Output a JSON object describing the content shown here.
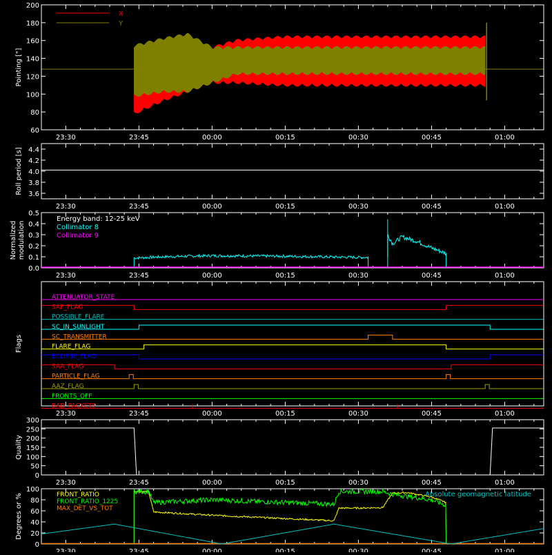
{
  "colors": {
    "background": "#000000",
    "axis": "#ffffff",
    "red": "#ff0000",
    "olive": "#808000",
    "cyan": "#00ffff",
    "magenta": "#ff00ff",
    "yellow": "#ffff00",
    "green": "#00ff00",
    "orange": "#ff8000",
    "blue": "#0000ff",
    "teal": "#00c0c0",
    "dark_yellow": "#a0a000"
  },
  "time_ticks": [
    "23:30",
    "23:45",
    "00:00",
    "00:15",
    "00:30",
    "00:45",
    "01:00"
  ],
  "chart_data": [
    {
      "id": "pointing",
      "type": "area",
      "ylabel": "Pointing [\"]",
      "ylim": [
        60,
        200
      ],
      "yticks": [
        60,
        80,
        100,
        120,
        140,
        160,
        180,
        200
      ],
      "legend_placement": "top-left",
      "x_range": [
        "23:25",
        "01:08"
      ],
      "series": [
        {
          "name": "X",
          "color": "#ff0000",
          "x": [
            "23:44",
            "23:50",
            "23:55",
            "00:00",
            "00:05",
            "00:15",
            "00:30",
            "00:45",
            "00:56"
          ],
          "upper": [
            152,
            150,
            145,
            150,
            158,
            162,
            162,
            162,
            162
          ],
          "lower": [
            80,
            95,
            105,
            115,
            115,
            112,
            112,
            112,
            112
          ]
        },
        {
          "name": "Y",
          "color": "#808000",
          "x": [
            "23:44",
            "23:50",
            "23:55",
            "00:00",
            "00:05",
            "00:15",
            "00:30",
            "00:45",
            "00:56"
          ],
          "upper": [
            152,
            160,
            165,
            150,
            150,
            150,
            150,
            150,
            150
          ],
          "lower": [
            100,
            105,
            105,
            115,
            125,
            125,
            125,
            125,
            125
          ]
        }
      ],
      "baseline": 128
    },
    {
      "id": "roll-period",
      "type": "line",
      "ylabel": "Roll period [s]",
      "ylim": [
        3.5,
        4.5
      ],
      "yticks": [
        3.6,
        3.8,
        4.0,
        4.2,
        4.4
      ],
      "series": [
        {
          "color": "#ffffff",
          "x": [
            "23:25",
            "01:08"
          ],
          "y": [
            4.02,
            4.02
          ]
        }
      ]
    },
    {
      "id": "modulation",
      "type": "line",
      "ylabel": "Normalized modulation",
      "ylabel_lines": [
        "Normalized",
        "modulation"
      ],
      "ylim": [
        0,
        0.5
      ],
      "yticks": [
        0.0,
        0.1,
        0.2,
        0.3,
        0.4,
        0.5
      ],
      "annotation": "Energy band: 12-25 keV",
      "legend": [
        "Collimator 8",
        "Collimator 9"
      ],
      "series": [
        {
          "name": "Collimator 8",
          "color": "#00ffff",
          "segments": [
            {
              "x": [
                "23:44",
                "23:50",
                "00:00",
                "00:15",
                "00:30",
                "00:32"
              ],
              "y": [
                0.09,
                0.1,
                0.11,
                0.105,
                0.095,
                0.095
              ]
            },
            {
              "x": [
                "00:36",
                "00:37",
                "00:38",
                "00:39",
                "00:42",
                "00:45",
                "00:48"
              ],
              "y": [
                0.3,
                0.22,
                0.25,
                0.28,
                0.24,
                0.18,
                0.13
              ]
            }
          ]
        },
        {
          "name": "Collimator 9",
          "color": "#ff00ff",
          "segments": [
            {
              "x": [
                "23:25",
                "01:08"
              ],
              "y": [
                0,
                0
              ]
            }
          ]
        }
      ]
    },
    {
      "id": "flags",
      "type": "line",
      "ylabel": "Flags",
      "flags": [
        {
          "label": "ATTENUATOR_STATE",
          "color": "#ff00ff",
          "transitions": []
        },
        {
          "label": "SAP_FLAG",
          "color": "#ff0000",
          "transitions": [
            [
              "23:44",
              "down"
            ],
            [
              "00:48",
              "up"
            ]
          ]
        },
        {
          "label": "POSSIBLE_FLARE",
          "color": "#00c0c0",
          "transitions": []
        },
        {
          "label": "SC_IN_SUNLIGHT",
          "color": "#00ffff",
          "transitions": [
            [
              "23:45",
              "up"
            ],
            [
              "00:57",
              "down"
            ]
          ]
        },
        {
          "label": "SC_TRANSMITTER",
          "color": "#ff8000",
          "transitions": [
            [
              "00:32",
              "up"
            ],
            [
              "00:37",
              "down"
            ]
          ]
        },
        {
          "label": "FLARE_FLAG",
          "color": "#ffff00",
          "transitions": [
            [
              "23:46",
              "up"
            ],
            [
              "00:48",
              "down"
            ]
          ]
        },
        {
          "label": "ECLIPSE_FLAG",
          "color": "#0000ff",
          "transitions": [
            [
              "23:45",
              "down"
            ],
            [
              "00:57",
              "up"
            ]
          ]
        },
        {
          "label": "SAA_FLAG",
          "color": "#ff0000",
          "transitions": [
            [
              "23:40",
              "down"
            ],
            [
              "00:49",
              "up"
            ]
          ]
        },
        {
          "label": "PARTICLE_FLAG",
          "color": "#ff8000",
          "transitions": [
            [
              "23:43",
              "pulse"
            ],
            [
              "00:48",
              "pulse"
            ]
          ]
        },
        {
          "label": "AAZ_FLAG",
          "color": "#a0a000",
          "transitions": [
            [
              "23:44",
              "pulse"
            ],
            [
              "00:56",
              "pulse"
            ]
          ]
        },
        {
          "label": "FRONTS_OFF",
          "color": "#00ff00",
          "transitions": []
        },
        {
          "label": "BAD_PACKETS",
          "color": "#ff0000",
          "transitions": [
            [
              "23:56",
              "spike"
            ],
            [
              "00:38",
              "spike"
            ]
          ]
        }
      ]
    },
    {
      "id": "quality",
      "type": "line",
      "ylabel": "Quality",
      "ylim": [
        0,
        300
      ],
      "yticks": [
        0,
        50,
        100,
        150,
        200,
        250,
        300
      ],
      "series": [
        {
          "color": "#ffffff",
          "x": [
            "23:25",
            "23:44",
            "23:44.5",
            "00:57",
            "00:57.5",
            "01:08"
          ],
          "y": [
            255,
            255,
            0,
            0,
            255,
            255
          ]
        }
      ]
    },
    {
      "id": "degrees",
      "type": "line",
      "ylabel": "Degrees or %",
      "ylim": [
        0,
        100
      ],
      "yticks": [
        0,
        20,
        40,
        60,
        80,
        100
      ],
      "legend": [
        "FRONT_RATIO",
        "FRONT_RATIO_1225",
        "MAX_DET_VS_TOT"
      ],
      "annotation": "Absolute geomagnetic latitude",
      "series": [
        {
          "name": "FRONT_RATIO",
          "color": "#ffff00",
          "x": [
            "23:44",
            "23:47",
            "23:48",
            "00:00",
            "00:15",
            "00:25",
            "00:26",
            "00:30",
            "00:35",
            "00:37",
            "00:40",
            "00:45",
            "00:48"
          ],
          "y": [
            95,
            95,
            58,
            52,
            46,
            42,
            65,
            65,
            66,
            92,
            93,
            85,
            75
          ]
        },
        {
          "name": "FRONT_RATIO_1225",
          "color": "#00ff00",
          "x": [
            "23:44",
            "23:47",
            "23:48",
            "00:00",
            "00:15",
            "00:25",
            "00:26",
            "00:35",
            "00:37",
            "00:45",
            "00:48"
          ],
          "y": [
            95,
            95,
            75,
            80,
            75,
            72,
            95,
            95,
            90,
            80,
            70
          ]
        },
        {
          "name": "MAX_DET_VS_TOT",
          "color": "#ff8000",
          "x": [
            "23:25",
            "01:08"
          ],
          "y": [
            0,
            0
          ]
        },
        {
          "name": "Absolute geomagnetic latitude",
          "color": "#00c0c0",
          "x": [
            "23:25",
            "23:40",
            "00:02",
            "00:25",
            "00:49",
            "01:08"
          ],
          "y": [
            18,
            36,
            0,
            36,
            0,
            28
          ]
        }
      ]
    }
  ]
}
